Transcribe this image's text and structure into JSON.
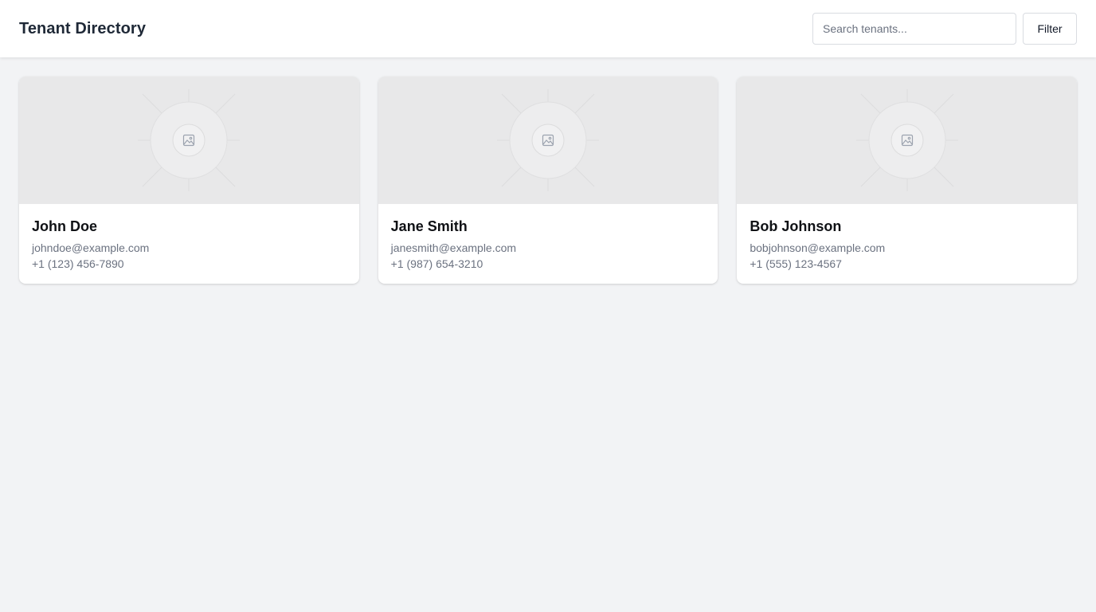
{
  "header": {
    "title": "Tenant Directory",
    "search": {
      "placeholder": "Search tenants...",
      "value": ""
    },
    "filter_label": "Filter"
  },
  "tenants": [
    {
      "name": "John Doe",
      "email": "johndoe@example.com",
      "phone": "+1 (123) 456-7890",
      "image_icon": "image-placeholder-icon"
    },
    {
      "name": "Jane Smith",
      "email": "janesmith@example.com",
      "phone": "+1 (987) 654-3210",
      "image_icon": "image-placeholder-icon"
    },
    {
      "name": "Bob Johnson",
      "email": "bobjohnson@example.com",
      "phone": "+1 (555) 123-4567",
      "image_icon": "image-placeholder-icon"
    }
  ],
  "colors": {
    "page_background": "#f2f3f5",
    "header_background": "#ffffff",
    "image_placeholder": "#e8e8e9",
    "muted_text": "#6b7280"
  }
}
